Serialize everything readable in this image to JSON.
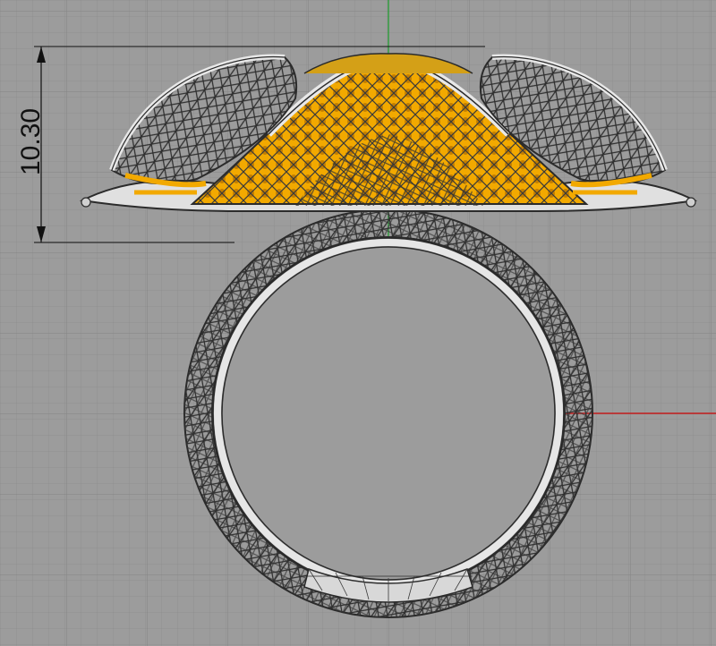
{
  "viewport": {
    "name": "Front",
    "background": "#9c9c9c",
    "grid_minor_color": "#8f8f8f",
    "grid_major_color": "#858585",
    "axis_x_color": "#c21a1a",
    "axis_y_color": "#1a9c2a"
  },
  "dimension": {
    "label": "10.30"
  },
  "model": {
    "description_icon": "filigree-ring-icon",
    "metal_color": "#d9d9d9",
    "wire_color": "#2b2b2b",
    "inlay_color": "#f2a900"
  }
}
